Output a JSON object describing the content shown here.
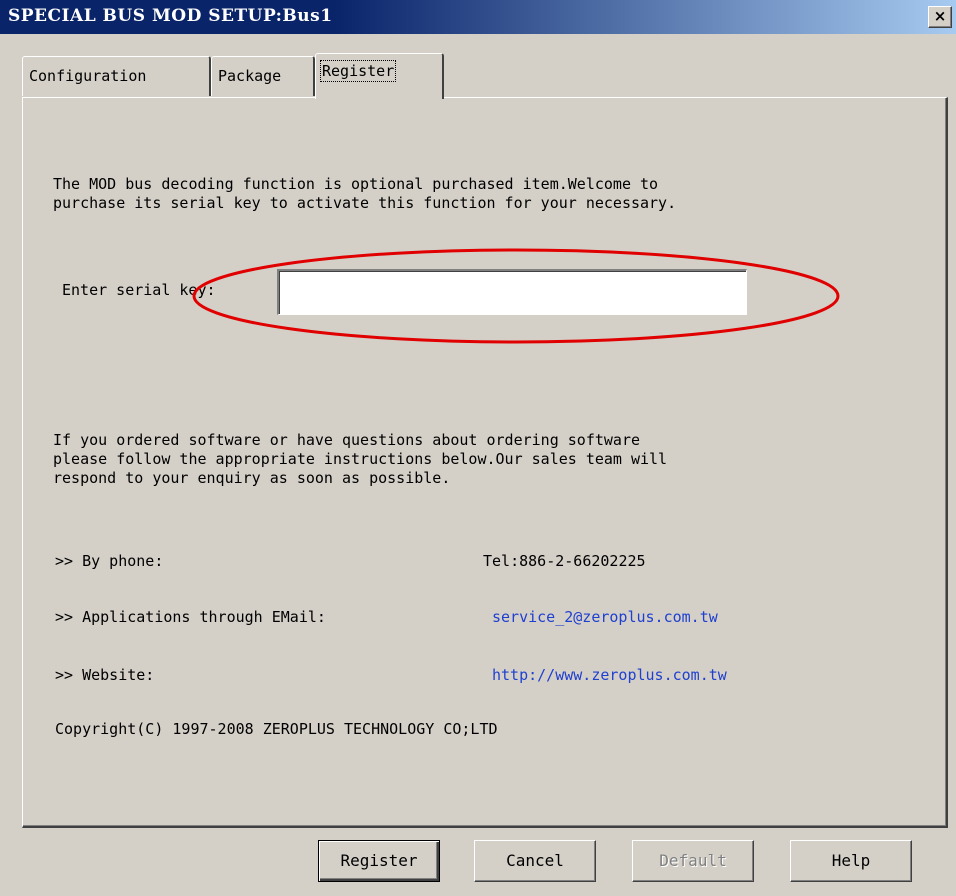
{
  "window": {
    "title": "SPECIAL BUS MOD SETUP:Bus1",
    "close_glyph": "×"
  },
  "tabs": [
    {
      "label": "Configuration",
      "active": false
    },
    {
      "label": "Package",
      "active": false
    },
    {
      "label": "Register",
      "active": true
    }
  ],
  "register": {
    "intro": "The MOD bus decoding function is optional purchased item.Welcome to\npurchase its serial key to activate this function for your necessary.",
    "serial_label": "Enter serial key:",
    "serial_value": "",
    "order_text": "If you ordered software or have questions about ordering software\nplease follow the appropriate instructions below.Our sales team will\nrespond to your enquiry as soon as possible.",
    "contacts": [
      {
        "label": ">> By phone:",
        "value": "Tel:886-2-66202225",
        "is_link": false
      },
      {
        "label": ">> Applications through EMail:",
        "value": "service_2@zeroplus.com.tw",
        "is_link": true
      },
      {
        "label": ">> Website:",
        "value": "http://www.zeroplus.com.tw",
        "is_link": true
      }
    ],
    "copyright": "Copyright(C) 1997-2008 ZEROPLUS TECHNOLOGY CO;LTD"
  },
  "buttons": {
    "register": "Register",
    "cancel": "Cancel",
    "default": "Default",
    "help": "Help"
  },
  "colors": {
    "titlebar": "#0a246a",
    "link": "#1f3fd0",
    "annotation": "#e00000"
  }
}
